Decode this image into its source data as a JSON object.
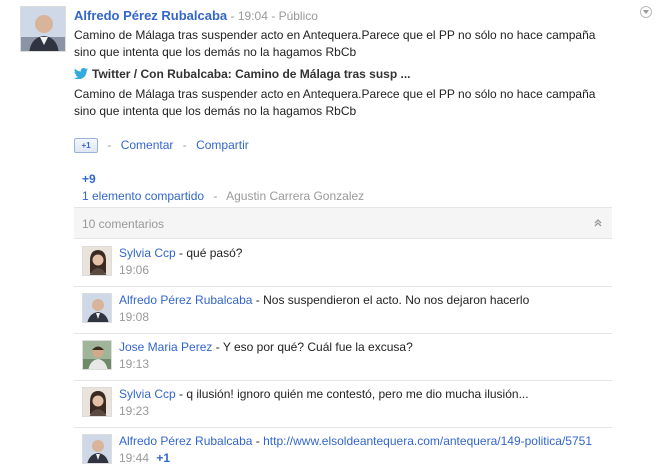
{
  "post": {
    "author": "Alfredo Pérez Rubalcaba",
    "time": "19:04",
    "visibility": "Público",
    "text": "Camino de Málaga tras suspender acto en Antequera.Parece que el PP no sólo no hace campaña sino que intenta que los demás no la hagamos RbCb",
    "shared_link_title": "Twitter / Con Rubalcaba: Camino de Málaga tras susp ...",
    "shared_text": "Camino de Málaga tras suspender acto en Antequera.Parece que el PP no sólo no hace campaña sino que intenta que los demás no la hagamos RbCb"
  },
  "actions": {
    "plusone_label": "+1",
    "comment": "Comentar",
    "share": "Compartir"
  },
  "stats": {
    "plus_count": "+9",
    "shared_count": "1 elemento compartido",
    "shared_by": "Agustin Carrera Gonzalez"
  },
  "comments_header": {
    "count": "10 comentarios"
  },
  "comments": [
    {
      "author": "Sylvia Ccp",
      "text": "qué pasó?",
      "time": "19:06",
      "plus": ""
    },
    {
      "author": "Alfredo Pérez Rubalcaba",
      "text": "Nos suspendieron el acto. No nos dejaron hacerlo",
      "time": "19:08",
      "plus": ""
    },
    {
      "author": "Jose Maria Perez",
      "text": "Y eso por qué? Cuál fue la excusa?",
      "time": "19:13",
      "plus": ""
    },
    {
      "author": "Sylvia Ccp",
      "text": "q ilusión! ignoro quién me contestó, pero me dio mucha ilusión...",
      "time": "19:23",
      "plus": ""
    },
    {
      "author": "Alfredo Pérez Rubalcaba",
      "text": "http://www.elsoldeantequera.com/antequera/149-politica/5751",
      "time": "19:44",
      "plus": "+1"
    }
  ],
  "colors": {
    "link": "#3366cc",
    "meta": "#999999",
    "bar_bg": "#f5f5f5"
  },
  "icons": [
    "dropdown-caret-icon",
    "twitter-bird-icon",
    "plusone-icon",
    "collapse-chevrons-icon"
  ]
}
